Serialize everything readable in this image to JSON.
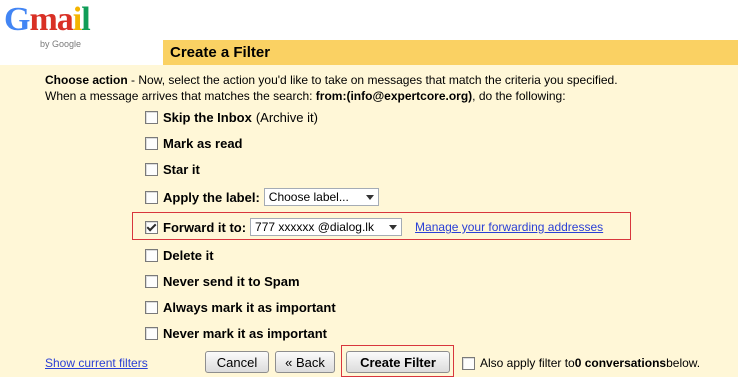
{
  "logo": {
    "brand": "Gmail",
    "byline": "by Google"
  },
  "header": {
    "title": "Create a Filter"
  },
  "intro": {
    "label": "Choose action",
    "line1_rest": " - Now, select the action you'd like to take on messages that match the criteria you specified.",
    "line2_prefix": "When a message arrives that matches the search: ",
    "search": "from:(info@expertcore.org)",
    "line2_suffix": ", do the following:"
  },
  "options": {
    "skip_inbox": {
      "label": "Skip the Inbox",
      "sub": "(Archive it)",
      "checked": false
    },
    "mark_read": {
      "label": "Mark as read",
      "checked": false
    },
    "star": {
      "label": "Star it",
      "checked": false
    },
    "apply_label": {
      "label": "Apply the label:",
      "select_value": "Choose label...",
      "checked": false
    },
    "forward": {
      "label": "Forward it to:",
      "select_value": "777 xxxxxx @dialog.lk",
      "manage_link": "Manage your forwarding addresses",
      "checked": true
    },
    "delete": {
      "label": "Delete it",
      "checked": false
    },
    "never_spam": {
      "label": "Never send it to Spam",
      "checked": false
    },
    "always_important": {
      "label": "Always mark it as important",
      "checked": false
    },
    "never_important": {
      "label": "Never mark it as important",
      "checked": false
    }
  },
  "footer": {
    "show_filters_link": "Show current filters",
    "cancel": "Cancel",
    "back": "« Back",
    "create": "Create Filter",
    "apply_prefix": "Also apply filter to ",
    "apply_count": "0 conversations",
    "apply_suffix": " below."
  },
  "colors": {
    "header_band": "#fad163",
    "panel": "#fff7d7",
    "link": "#2a3fd6",
    "highlight": "#d8363d"
  }
}
